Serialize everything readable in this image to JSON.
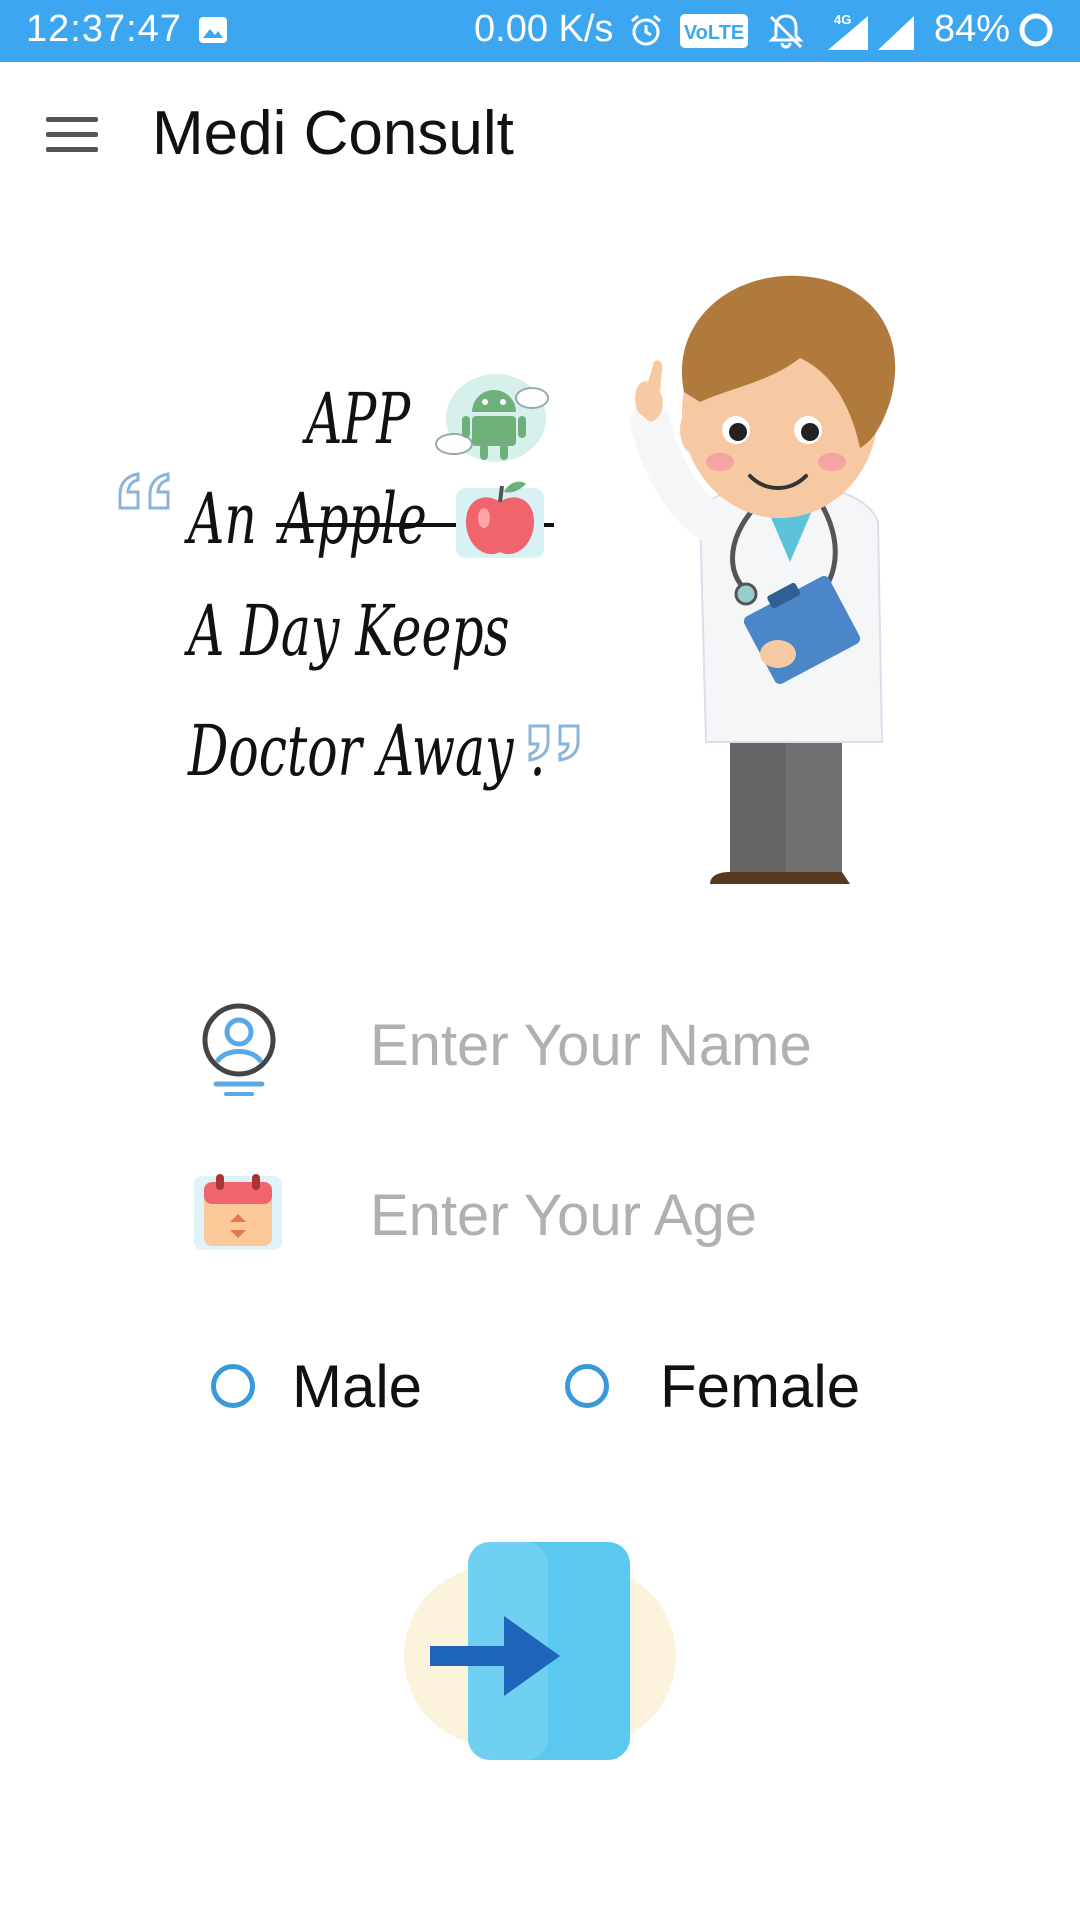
{
  "status_bar": {
    "time": "12:37:47",
    "network_speed": "0.00 K/s",
    "volte": "VoLTE",
    "network_type": "4G",
    "battery": "84%"
  },
  "toolbar": {
    "title": "Medi Consult"
  },
  "quote": {
    "line0": "APP",
    "line1_a": "An",
    "line1_b": "Apple",
    "line2": "A Day Keeps",
    "line3": "Doctor Away ."
  },
  "form": {
    "name_placeholder": "Enter Your Name",
    "age_placeholder": "Enter Your Age",
    "gender_options": [
      "Male",
      "Female"
    ]
  },
  "colors": {
    "status_bar": "#3da6f0",
    "accent": "#3a9ad9"
  }
}
